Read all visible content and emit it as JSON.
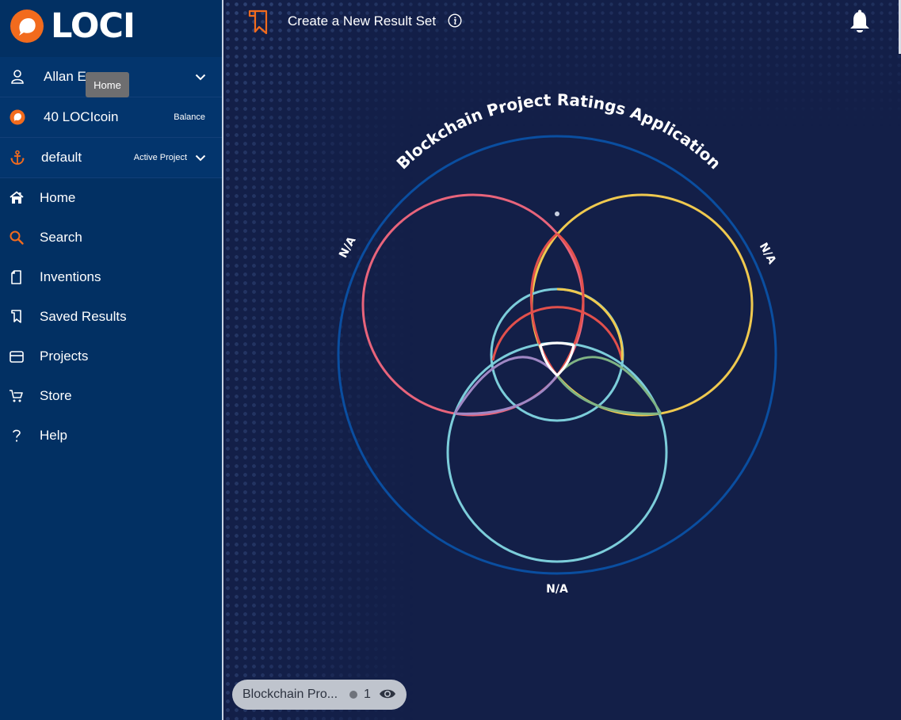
{
  "brand": {
    "name": "LOCI",
    "accent": "#f26b1d"
  },
  "user": {
    "name": "Allan Ewart",
    "icon": "user-icon"
  },
  "tooltip": {
    "text": "Home"
  },
  "wallet": {
    "amount": "40 LOCIcoin",
    "label": "Balance",
    "icon": "loci-coin-icon"
  },
  "project": {
    "name": "default",
    "label": "Active Project",
    "icon": "anchor-icon"
  },
  "nav": [
    {
      "label": "Home",
      "icon": "home-icon"
    },
    {
      "label": "Search",
      "icon": "search-icon"
    },
    {
      "label": "Inventions",
      "icon": "document-icon"
    },
    {
      "label": "Saved Results",
      "icon": "bookmark-icon"
    },
    {
      "label": "Projects",
      "icon": "folder-icon"
    },
    {
      "label": "Store",
      "icon": "cart-icon"
    },
    {
      "label": "Help",
      "icon": "question-icon"
    }
  ],
  "topbar": {
    "title": "Create a New Result Set"
  },
  "venn": {
    "title": "Blockchain Project Ratings Application",
    "label_left": "N/A",
    "label_right": "N/A",
    "label_bottom": "N/A",
    "colors": {
      "outer": "#0a4ea0",
      "left": "#e8647b",
      "right": "#efc94f",
      "bottom": "#7ccdda",
      "center": "#e2504c",
      "purple": "#9f87c4",
      "green": "#7fb384",
      "intersection": "#ffffff"
    }
  },
  "result_chip": {
    "label": "Blockchain Pro...",
    "count": "1"
  }
}
